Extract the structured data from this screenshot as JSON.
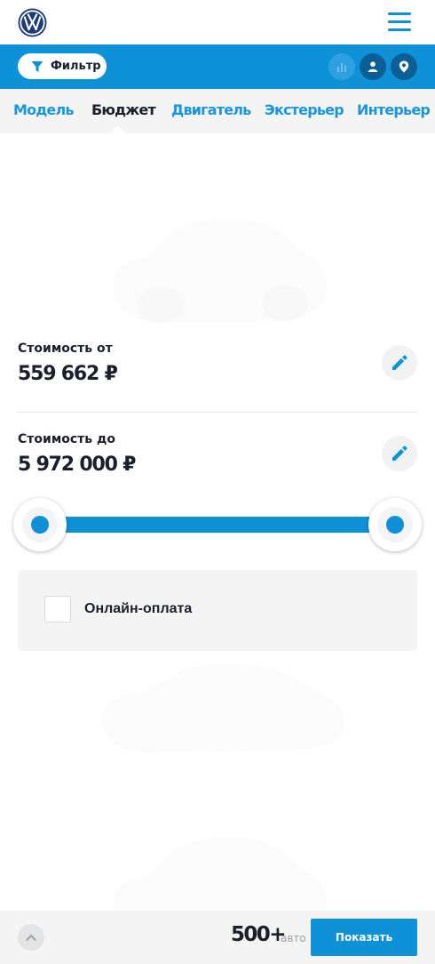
{
  "header": {
    "logo_icon": "volkswagen-logo-icon",
    "menu_icon": "hamburger-menu-icon"
  },
  "toolbar": {
    "filter_label": "Фильтр",
    "filter_icon": "funnel-icon",
    "buttons": [
      "bar-chart-icon",
      "user-icon",
      "map-pin-icon"
    ]
  },
  "tabs": [
    {
      "label": "Модель",
      "active": false
    },
    {
      "label": "Бюджет",
      "active": true
    },
    {
      "label": "Двигатель",
      "active": false
    },
    {
      "label": "Экстерьер",
      "active": false
    },
    {
      "label": "Интерьер",
      "active": false
    }
  ],
  "budget": {
    "from_label": "Стоимость от",
    "from_value": "559 662 ₽",
    "to_label": "Стоимость до",
    "to_value": "5 972 000 ₽",
    "edit_icon": "pencil-icon"
  },
  "online_payment": {
    "label": "Онлайн-оплата",
    "checked": false
  },
  "bottom_bar": {
    "up_icon": "chevron-up-icon",
    "count": "500+",
    "count_unit": "авто",
    "show_label": "Показать"
  },
  "colors": {
    "accent": "#0f91d8",
    "accent_dark": "#0b5f94",
    "text": "#1a1f2b",
    "panel": "#f4f4f5"
  }
}
